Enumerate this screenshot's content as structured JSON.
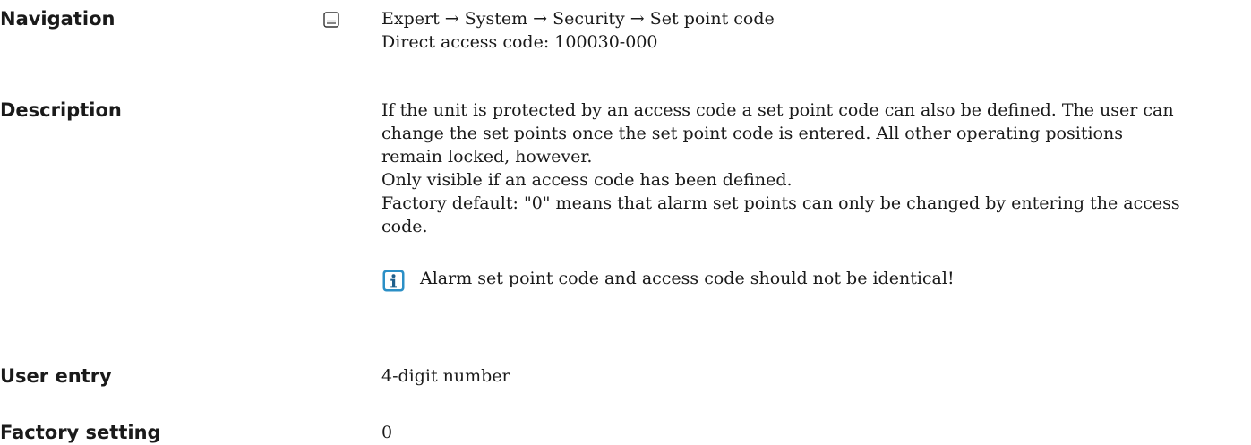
{
  "navigation": {
    "label": "Navigation",
    "icon": "menu-panel-icon",
    "path": "Expert → System → Security → Set point code",
    "direct_access": "Direct access code: 100030-000"
  },
  "description": {
    "label": "Description",
    "lines": [
      "If the unit is protected by an access code a set point code can also be defined. The user can",
      "change the set points once the set point code is entered. All other operating positions",
      "remain locked, however.",
      "Only visible if an access code has been defined.",
      "Factory default: \"0\" means that alarm set points can only be changed by entering the access",
      "code."
    ],
    "note": {
      "icon": "info-icon",
      "text": "Alarm set point code and access code should not be identical!"
    }
  },
  "user_entry": {
    "label": "User entry",
    "value": "4-digit number"
  },
  "factory_setting": {
    "label": "Factory setting",
    "value": "0"
  },
  "colors": {
    "info_icon": "#2b8fc6",
    "text": "#1a1a1a"
  }
}
